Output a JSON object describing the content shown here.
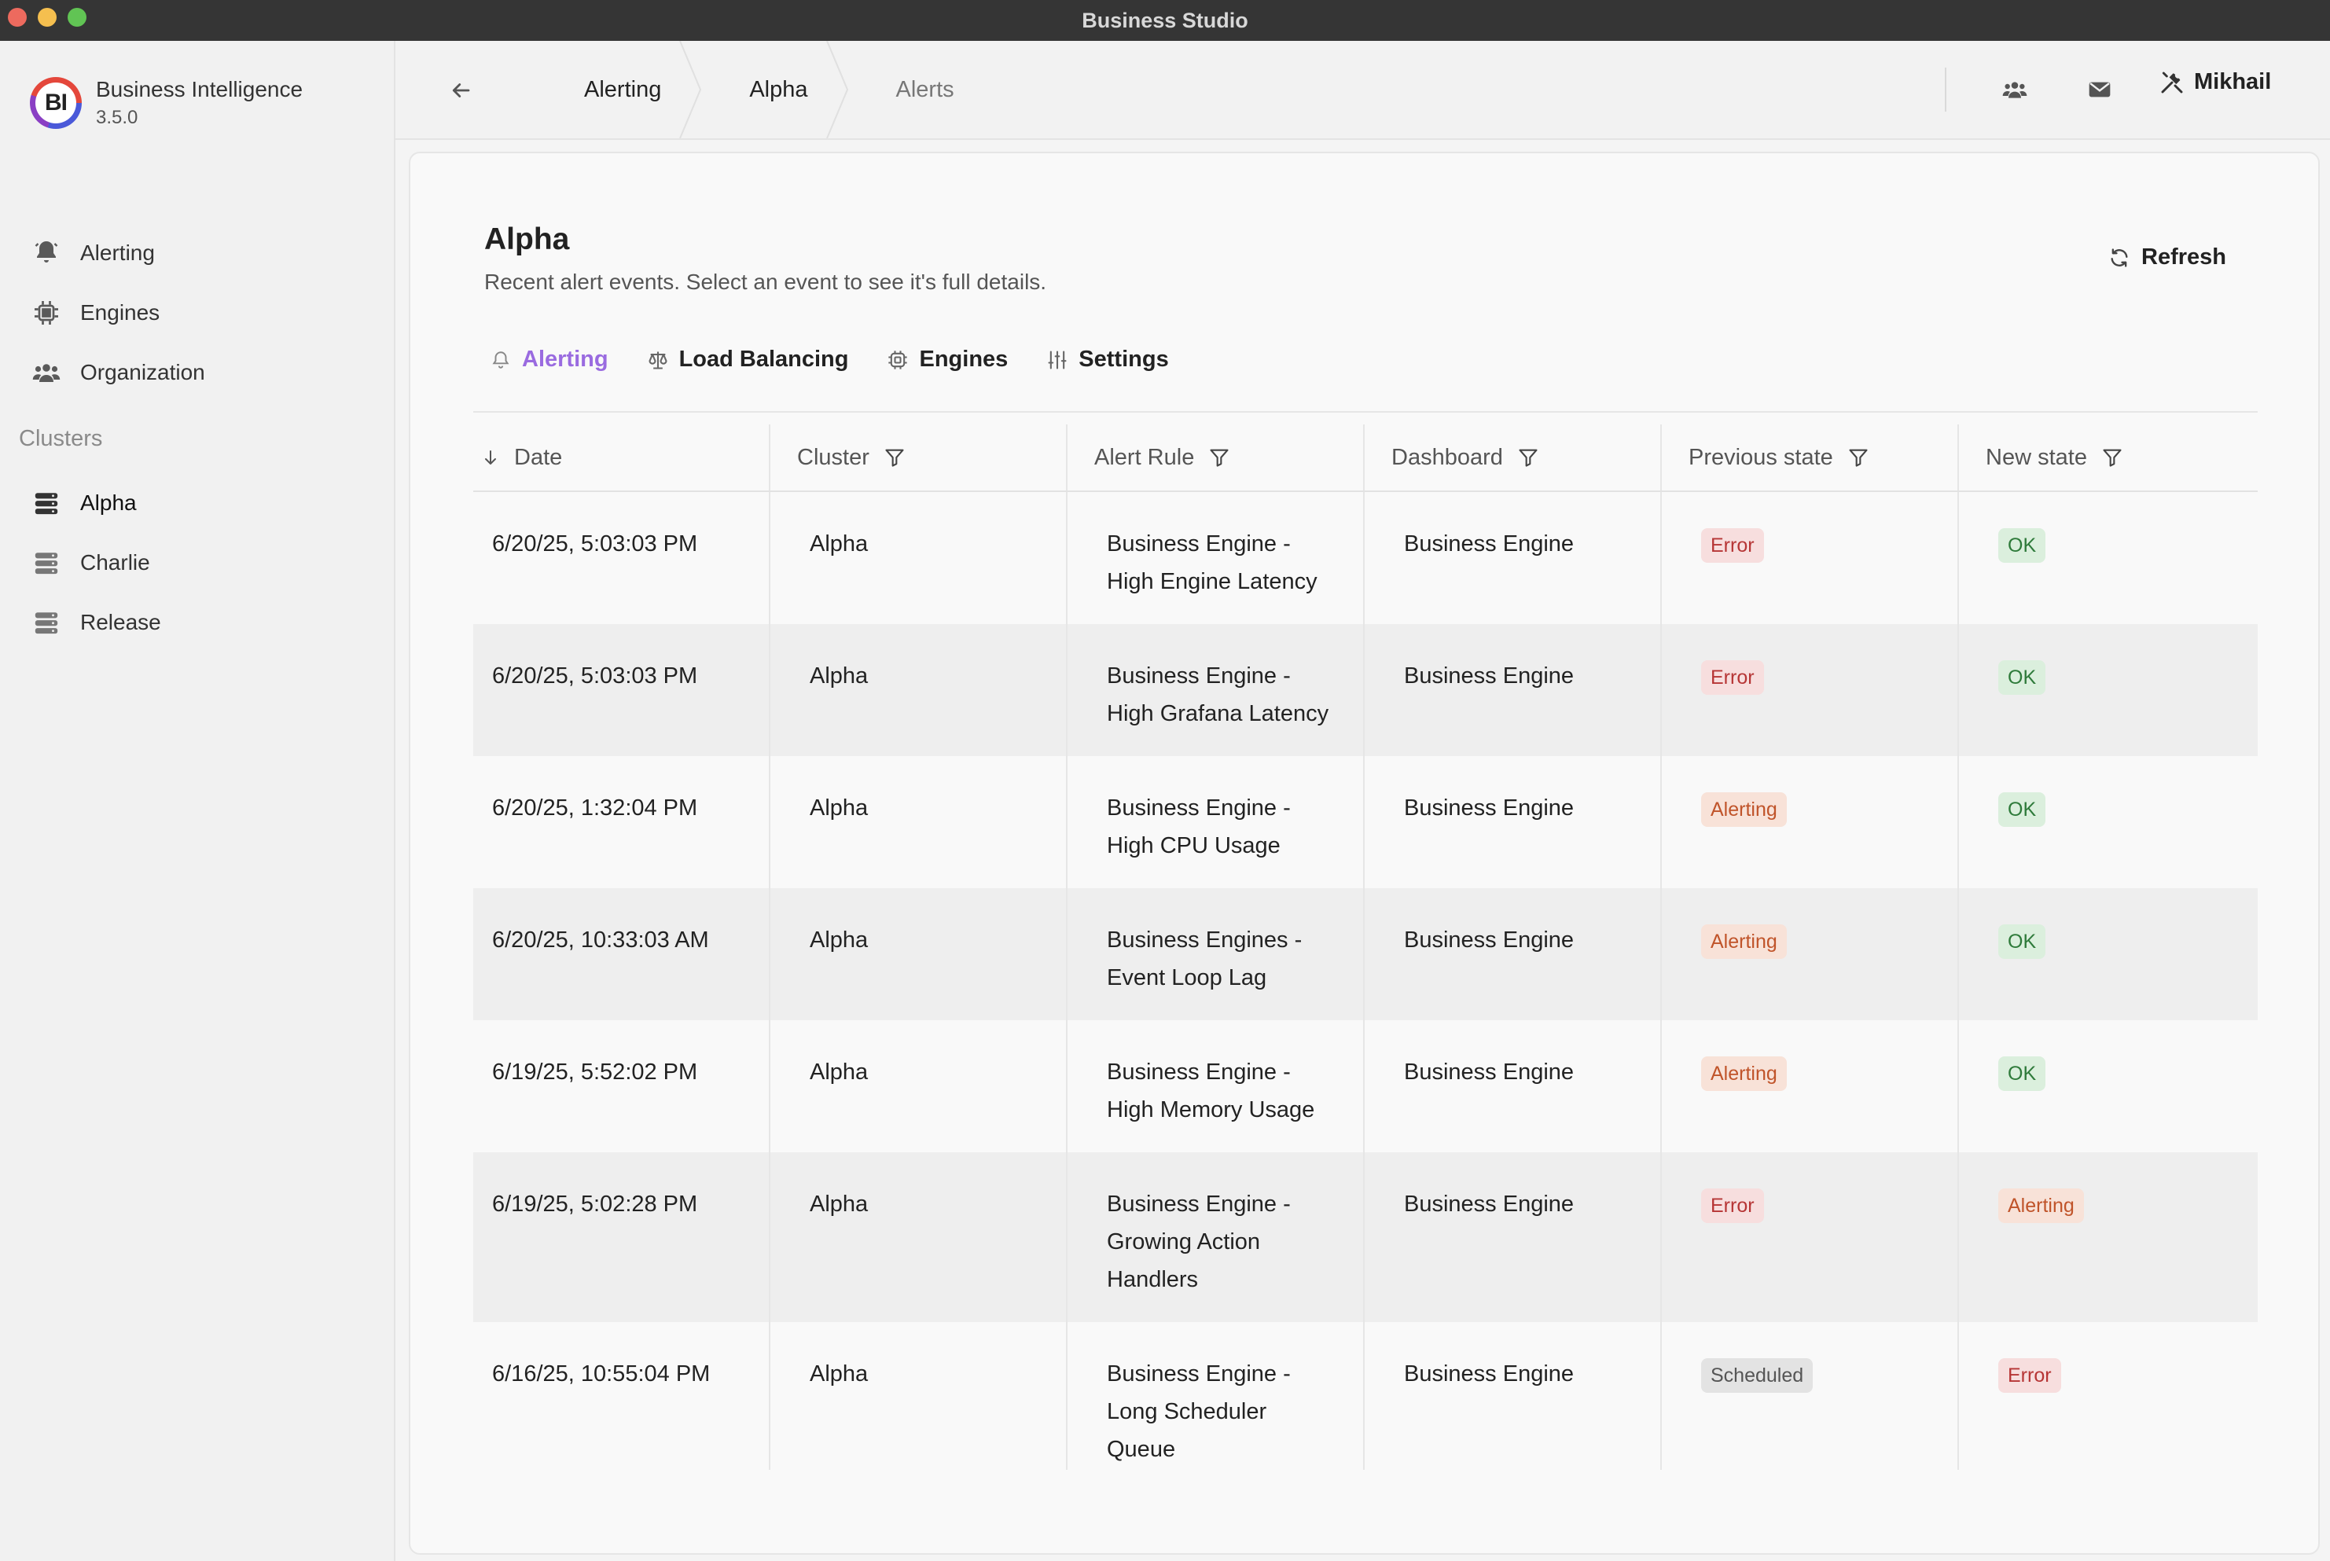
{
  "window": {
    "title": "Business Studio"
  },
  "brand": {
    "name": "Business Intelligence",
    "version": "3.5.0",
    "logo_text": "BI"
  },
  "sidebar": {
    "items": [
      {
        "label": "Alerting",
        "icon": "bell-icon"
      },
      {
        "label": "Engines",
        "icon": "chip-icon"
      },
      {
        "label": "Organization",
        "icon": "users-icon"
      }
    ],
    "clusters_label": "Clusters",
    "clusters": [
      {
        "label": "Alpha",
        "icon": "server-icon",
        "active": true
      },
      {
        "label": "Charlie",
        "icon": "server-icon",
        "active": false
      },
      {
        "label": "Release",
        "icon": "server-icon",
        "active": false
      }
    ]
  },
  "header": {
    "breadcrumbs": [
      "Alerting",
      "Alpha",
      "Alerts"
    ],
    "user": "Mikhail"
  },
  "page": {
    "title": "Alpha",
    "subtitle": "Recent alert events. Select an event to see it's full details.",
    "refresh_label": "Refresh",
    "tabs": [
      {
        "label": "Alerting",
        "icon": "bell-icon",
        "active": true
      },
      {
        "label": "Load Balancing",
        "icon": "scale-icon",
        "active": false
      },
      {
        "label": "Engines",
        "icon": "chip-icon",
        "active": false
      },
      {
        "label": "Settings",
        "icon": "sliders-icon",
        "active": false
      }
    ]
  },
  "table": {
    "columns": [
      "Date",
      "Cluster",
      "Alert Rule",
      "Dashboard",
      "Previous state",
      "New state"
    ],
    "rows": [
      {
        "date": "6/20/25, 5:03:03 PM",
        "cluster": "Alpha",
        "rule": [
          "Business Engine -",
          "High Engine Latency"
        ],
        "dashboard": "Business Engine",
        "prev": "Error",
        "new": "OK"
      },
      {
        "date": "6/20/25, 5:03:03 PM",
        "cluster": "Alpha",
        "rule": [
          "Business Engine -",
          "High Grafana Latency"
        ],
        "dashboard": "Business Engine",
        "prev": "Error",
        "new": "OK"
      },
      {
        "date": "6/20/25, 1:32:04 PM",
        "cluster": "Alpha",
        "rule": [
          "Business Engine -",
          "High CPU Usage"
        ],
        "dashboard": "Business Engine",
        "prev": "Alerting",
        "new": "OK"
      },
      {
        "date": "6/20/25, 10:33:03 AM",
        "cluster": "Alpha",
        "rule": [
          "Business Engines -",
          "Event Loop Lag"
        ],
        "dashboard": "Business Engine",
        "prev": "Alerting",
        "new": "OK"
      },
      {
        "date": "6/19/25, 5:52:02 PM",
        "cluster": "Alpha",
        "rule": [
          "Business Engine -",
          "High Memory Usage"
        ],
        "dashboard": "Business Engine",
        "prev": "Alerting",
        "new": "OK"
      },
      {
        "date": "6/19/25, 5:02:28 PM",
        "cluster": "Alpha",
        "rule": [
          "Business Engine -",
          "Growing Action",
          "Handlers"
        ],
        "dashboard": "Business Engine",
        "prev": "Error",
        "new": "Alerting"
      },
      {
        "date": "6/16/25, 10:55:04 PM",
        "cluster": "Alpha",
        "rule": [
          "Business Engine -",
          "Long Scheduler",
          "Queue"
        ],
        "dashboard": "Business Engine",
        "prev": "Scheduled",
        "new": "Error"
      }
    ]
  },
  "colors": {
    "accent": "#9a6be0",
    "error_bg": "#f7dede",
    "error_fg": "#b63535",
    "alerting_bg": "#f8e2d8",
    "alerting_fg": "#c0542a",
    "ok_bg": "#dbefdd",
    "ok_fg": "#2e7a3a",
    "scheduled_bg": "#e3e3e3",
    "scheduled_fg": "#555555"
  }
}
